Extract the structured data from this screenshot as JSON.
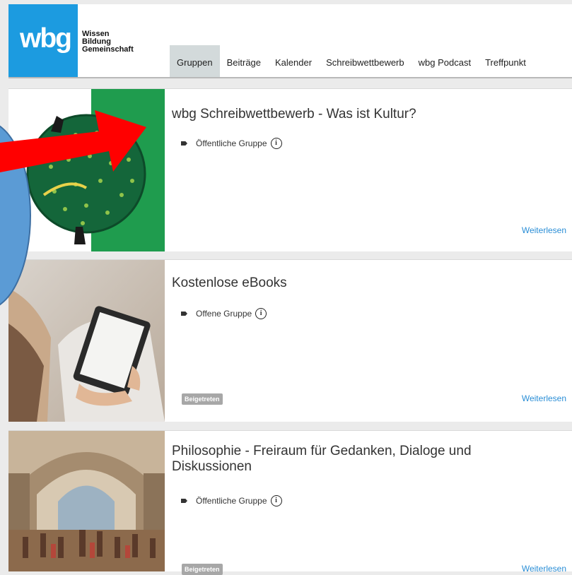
{
  "logo": {
    "mark": "wbg",
    "line1": "Wissen",
    "line2": "Bildung",
    "line3": "Gemeinschaft"
  },
  "nav": {
    "items": [
      {
        "label": "Gruppen",
        "active": true
      },
      {
        "label": "Beiträge"
      },
      {
        "label": "Kalender"
      },
      {
        "label": "Schreibwettbewerb"
      },
      {
        "label": "wbg Podcast"
      },
      {
        "label": "Treffpunkt"
      }
    ]
  },
  "groups": [
    {
      "title": "wbg Schreibwettbewerb - Was ist Kultur?",
      "type": "Öffentliche Gruppe",
      "more": "Weiterlesen",
      "image": "globe-illustration"
    },
    {
      "title": "Kostenlose eBooks",
      "type": "Offene Gruppe",
      "badge": "Beigetreten",
      "more": "Weiterlesen",
      "image": "ereader-photo"
    },
    {
      "title": "Philosophie - Freiraum für Gedanken, Dialoge und Diskussionen",
      "type": "Öffentliche Gruppe",
      "badge": "Beigetreten",
      "more": "Weiterlesen",
      "image": "school-of-athens-painting"
    }
  ],
  "icons": {
    "tag": "tag-icon",
    "info": "info-icon"
  },
  "colors": {
    "brand_blue": "#1c9be0",
    "link": "#2a8ed6",
    "annotation_arrow": "#ff0000",
    "annotation_circle": "#5b9bd5",
    "thumb_green": "#1f9c4e"
  }
}
